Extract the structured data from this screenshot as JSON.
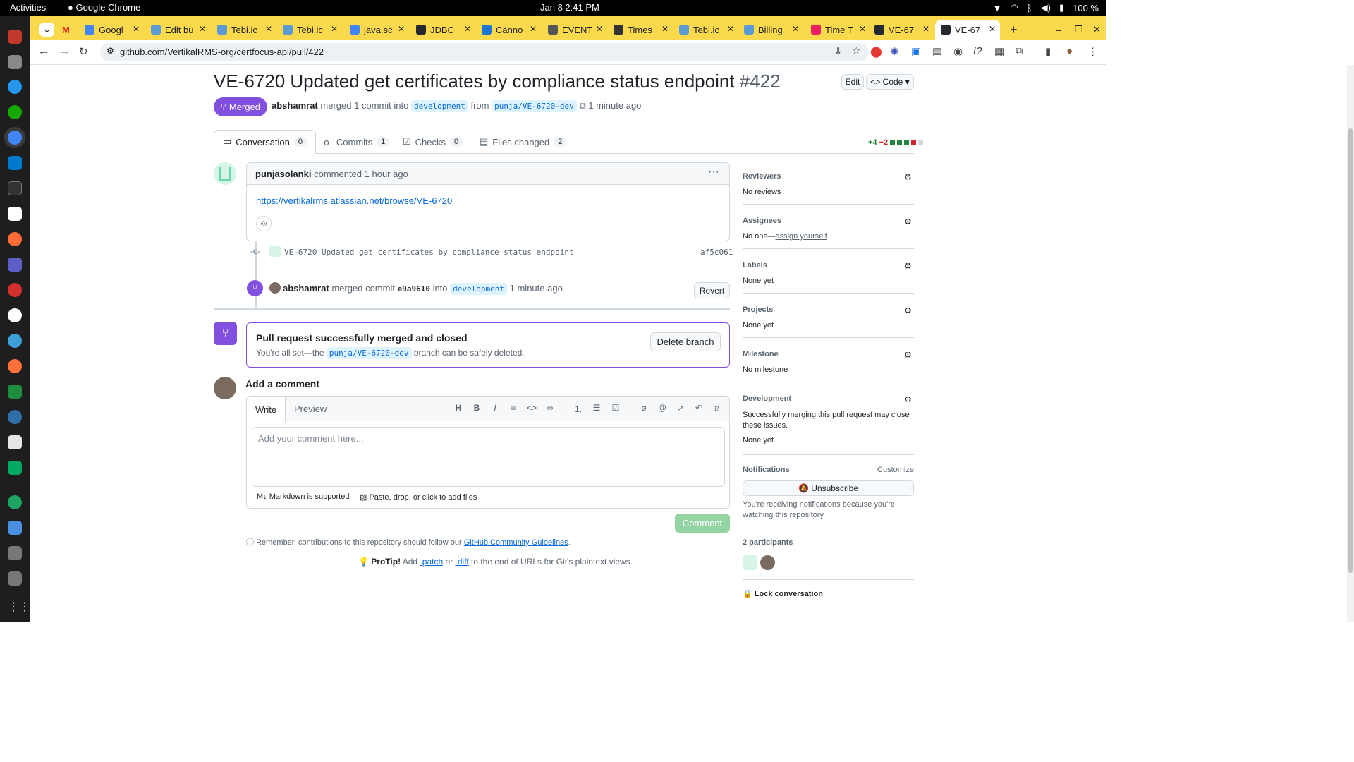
{
  "system": {
    "activities": "Activities",
    "app": "Google Chrome",
    "datetime": "Jan 8  2:41 PM",
    "battery": "100 %"
  },
  "browser": {
    "tabs": [
      {
        "label": "Googl",
        "color": "#4285f4"
      },
      {
        "label": "Edit bu",
        "color": "#5b9bd5"
      },
      {
        "label": "Tebi.ic",
        "color": "#5b9bd5"
      },
      {
        "label": "Tebi.ic",
        "color": "#5b9bd5"
      },
      {
        "label": "java.sc",
        "color": "#4285f4"
      },
      {
        "label": "JDBC",
        "color": "#24292f"
      },
      {
        "label": "Canno",
        "color": "#1976d2"
      },
      {
        "label": "EVENT",
        "color": "#555"
      },
      {
        "label": "Times",
        "color": "#333"
      },
      {
        "label": "Tebi.ic",
        "color": "#5b9bd5"
      },
      {
        "label": "Billing",
        "color": "#5b9bd5"
      },
      {
        "label": "Time T",
        "color": "#e91e63"
      },
      {
        "label": "VE-67",
        "color": "#24292f"
      },
      {
        "label": "VE-67",
        "color": "#24292f"
      }
    ],
    "url": "github.com/VertikalRMS-org/certfocus-api/pull/422"
  },
  "pr": {
    "title": "VE-6720 Updated get certificates by compliance status endpoint",
    "number": "#422",
    "edit": "Edit",
    "code": "Code",
    "status": "Merged",
    "author": "abshamrat",
    "merged_text": "merged 1 commit into",
    "base": "development",
    "from": "from",
    "head": "punja/VE-6720-dev",
    "time": "1 minute ago",
    "tabs": [
      {
        "label": "Conversation",
        "count": "0"
      },
      {
        "label": "Commits",
        "count": "1"
      },
      {
        "label": "Checks",
        "count": "0"
      },
      {
        "label": "Files changed",
        "count": "2"
      }
    ],
    "additions": "+4",
    "deletions": "−2"
  },
  "comment": {
    "author": "punjasolanki",
    "action": "commented",
    "time": "1 hour ago",
    "link": "https://vertikalrms.atlassian.net/browse/VE-6720"
  },
  "commit": {
    "message": "VE-6720 Updated get certificates by compliance status endpoint",
    "sha": "af5c061"
  },
  "merge_event": {
    "author": "abshamrat",
    "text1": "merged commit",
    "sha": "e9a9610",
    "text2": "into",
    "branch": "development",
    "time": "1 minute ago",
    "revert": "Revert"
  },
  "merge_box": {
    "title": "Pull request successfully merged and closed",
    "text1": "You're all set—the",
    "branch": "punja/VE-6720-dev",
    "text2": "branch can be safely deleted.",
    "delete": "Delete branch"
  },
  "add_comment": {
    "title": "Add a comment",
    "write": "Write",
    "preview": "Preview",
    "placeholder": "Add your comment here...",
    "markdown": "Markdown is supported",
    "files": "Paste, drop, or click to add files",
    "submit": "Comment",
    "remember": "Remember, contributions to this repository should follow our",
    "guidelines": "GitHub Community Guidelines",
    "protip_label": "ProTip!",
    "protip_add": "Add",
    "patch": ".patch",
    "or": "or",
    "diff": ".diff",
    "protip_rest": "to the end of URLs for Git's plaintext views."
  },
  "sidebar": {
    "reviewers": {
      "label": "Reviewers",
      "value": "No reviews"
    },
    "assignees": {
      "label": "Assignees",
      "value": "No one—",
      "link": "assign yourself"
    },
    "labels": {
      "label": "Labels",
      "value": "None yet"
    },
    "projects": {
      "label": "Projects",
      "value": "None yet"
    },
    "milestone": {
      "label": "Milestone",
      "value": "No milestone"
    },
    "development": {
      "label": "Development",
      "text": "Successfully merging this pull request may close these issues.",
      "value": "None yet"
    },
    "notifications": {
      "label": "Notifications",
      "customize": "Customize",
      "button": "Unsubscribe",
      "text": "You're receiving notifications because you're watching this repository."
    },
    "participants": {
      "label": "2 participants"
    },
    "lock": "Lock conversation"
  }
}
